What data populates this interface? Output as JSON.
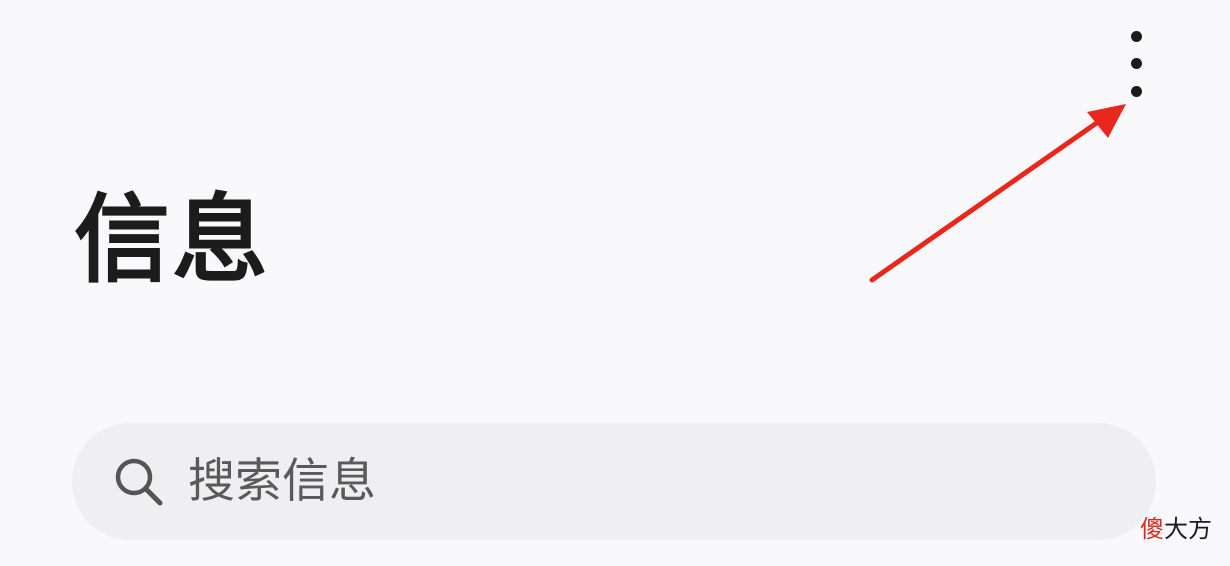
{
  "header": {
    "more_menu_icon": "more-vertical-icon",
    "title": "信息"
  },
  "search": {
    "icon": "search-icon",
    "placeholder": "搜索信息"
  },
  "annotation": {
    "arrow_color": "#e8271d"
  },
  "watermark": {
    "first_char": "傻",
    "rest": "大方",
    "accent_color": "#d8281f"
  }
}
